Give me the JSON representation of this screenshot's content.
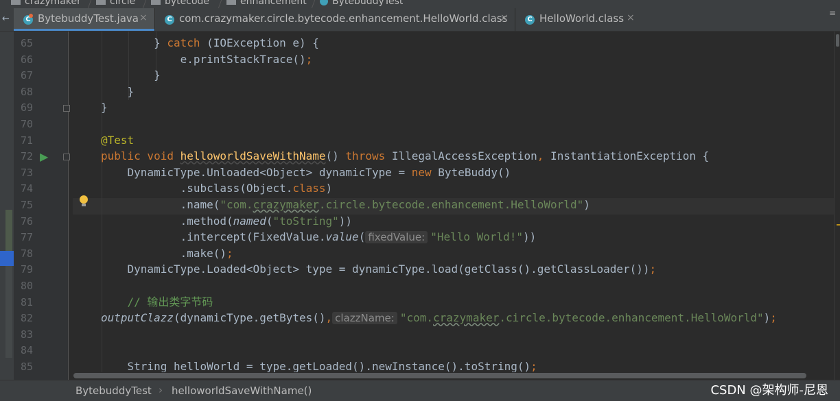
{
  "breadcrumbs": [
    "crazymaker",
    "circle",
    "bytecode",
    "enhancement",
    "BytebuddyTest"
  ],
  "tabs": [
    {
      "label": "BytebuddyTest.java",
      "icon": "C",
      "close": "×",
      "active": true
    },
    {
      "label": "com.crazymaker.circle.bytecode.enhancement.HelloWorld.class",
      "icon": "C",
      "close": "×",
      "active": false
    },
    {
      "label": "HelloWorld.class",
      "icon": "C",
      "close": "×",
      "active": false
    }
  ],
  "tab_menu": "≡",
  "left_arrow": "←",
  "line_numbers": [
    "65",
    "66",
    "67",
    "68",
    "69",
    "70",
    "71",
    "72",
    "73",
    "74",
    "75",
    "76",
    "77",
    "78",
    "79",
    "80",
    "81",
    "82",
    "83",
    "84",
    "85"
  ],
  "code": {
    "l65_a": "        } ",
    "l65_kw": "catch",
    "l65_b": " (IOException e) {",
    "l66_a": "            e.printStackTrace()",
    "l66_semi": ";",
    "l67": "        }",
    "l68": "    }",
    "l69": "}",
    "l71": "@Test",
    "l72_kw1": "public void ",
    "l72_fn": "helloworldSaveWithName",
    "l72_a": "() ",
    "l72_kw2": "throws",
    "l72_b": " IllegalAccessException",
    "l72_comma": ",",
    "l72_c": " InstantiationException {",
    "l73_a": "    DynamicType.Unloaded<Object> dynamicType = ",
    "l73_kw": "new",
    "l73_b": " ByteBuddy()",
    "l74_a": "            .subclass(Object.",
    "l74_kw": "class",
    "l74_b": ")",
    "l75_a": "            .name(",
    "l75_s1": "\"com.",
    "l75_s2": "crazymaker",
    "l75_s3": ".circle.bytecode.enhancement.HelloWorld\"",
    "l75_b": ")",
    "l76_a": "            .method(",
    "l76_it": "named",
    "l76_b": "(",
    "l76_s": "\"toString\"",
    "l76_c": "))",
    "l77_a": "            .intercept(FixedValue.",
    "l77_it": "value",
    "l77_b": "(",
    "l77_hint": "fixedValue:",
    "l77_s": "\"Hello World!\"",
    "l77_c": "))",
    "l78_a": "            .make()",
    "l78_semi": ";",
    "l79_a": "    DynamicType.Loaded<Object> type = dynamicType.load(getClass().getClassLoader())",
    "l79_semi": ";",
    "l81": "    // 输出类字节码",
    "l82_it": "outputClazz",
    "l82_a": "(dynamicType.getBytes()",
    "l82_comma": ",",
    "l82_hint": "clazzName:",
    "l82_s1": "\"com.",
    "l82_s2": "crazymaker",
    "l82_s3": ".circle.bytecode.enhancement.HelloWorld\"",
    "l82_b": ")",
    "l82_semi": ";",
    "l85_a": "    String helloWorld = type.getLoaded().newInstance().toString()",
    "l85_semi": ";"
  },
  "status": {
    "class_crumb": "BytebuddyTest",
    "separator": "›",
    "method_crumb": "helloworldSaveWithName()",
    "watermark": "CSDN @架构师-尼恩"
  },
  "colors": {
    "keyword": "#cc7832",
    "string": "#6a8759",
    "annotation": "#bbb529",
    "method": "#ffc66d",
    "comment": "#808080",
    "text": "#a9b7c6"
  }
}
